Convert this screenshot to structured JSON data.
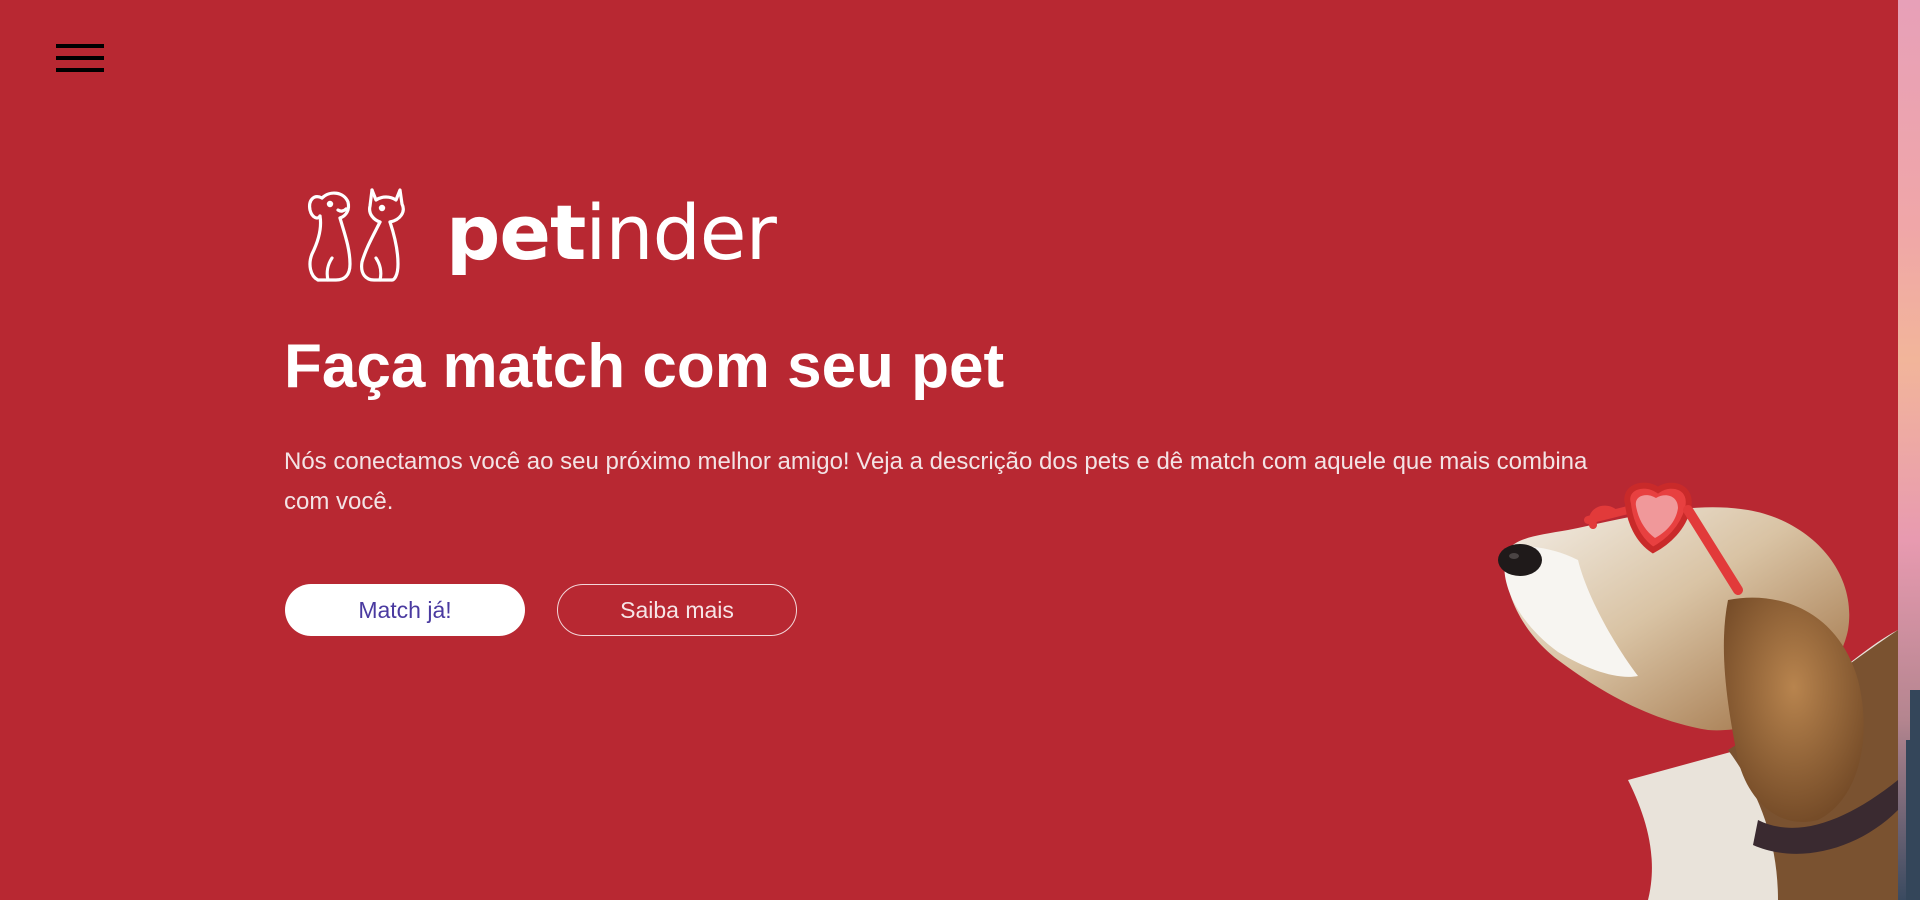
{
  "menu": {
    "icon": "hamburger-menu-icon"
  },
  "brand": {
    "logo_icon": "dog-and-cat-icon",
    "name_bold": "pet",
    "name_regular": "inder"
  },
  "hero": {
    "title": "Faça match com seu pet",
    "subtitle": "Nós conectamos você ao seu próximo melhor amigo! Veja a descrição dos pets e dê match com aquele que mais combina com você.",
    "primary_button": "Match já!",
    "secondary_button": "Saiba mais",
    "image": "beagle-with-heart-sunglasses"
  },
  "colors": {
    "background": "#B82832",
    "primary_button_bg": "#FFFFFF",
    "primary_button_text": "#4A3AA0",
    "text": "#FFFFFF"
  }
}
